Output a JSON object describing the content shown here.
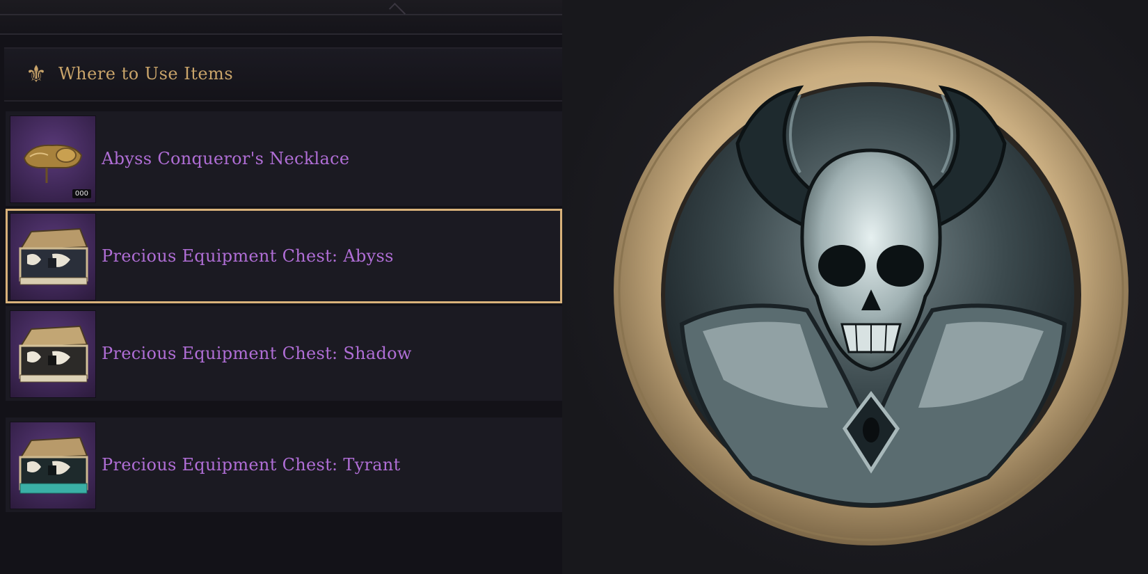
{
  "header": {
    "title": "Where to Use Items",
    "icon": "fleur-de-lis-icon"
  },
  "items": [
    {
      "label": "Abyss Conqueror's Necklace",
      "icon": "necklace-icon",
      "badge": "000",
      "selected": false
    },
    {
      "label": "Precious Equipment Chest: Abyss",
      "icon": "treasure-chest-icon",
      "selected": true
    },
    {
      "label": "Precious Equipment Chest: Shadow",
      "icon": "treasure-chest-icon",
      "selected": false
    },
    {
      "label": "Precious Equipment Chest: Tyrant",
      "icon": "treasure-chest-icon",
      "selected": false
    }
  ],
  "colors": {
    "gold": "#d9b27a",
    "purple_text": "#b06ed6",
    "panel_bg": "#131218"
  },
  "medallion": {
    "icon": "horned-skull-emblem-icon"
  }
}
